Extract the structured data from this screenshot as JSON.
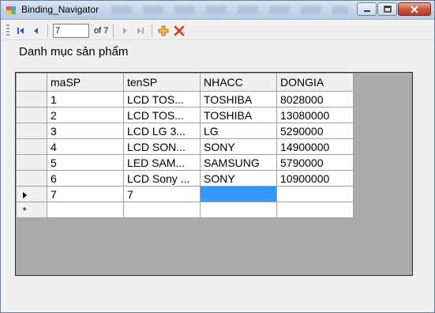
{
  "window": {
    "title": "Binding_Navigator"
  },
  "navigator": {
    "position_value": "7",
    "count_label": "of 7"
  },
  "section_label": "Danh mục sản phẩm",
  "grid": {
    "columns": [
      "maSP",
      "tenSP",
      "NHACC",
      "DONGIA"
    ],
    "rows": [
      [
        "1",
        "LCD TOS...",
        "TOSHIBA",
        "8028000"
      ],
      [
        "2",
        "LCD TOS...",
        "TOSHIBA",
        "13080000"
      ],
      [
        "3",
        "LCD LG 3...",
        "LG",
        "5290000"
      ],
      [
        "4",
        "LCD SON...",
        "SONY",
        "14900000"
      ],
      [
        "5",
        "LED SAM...",
        "SAMSUNG",
        "5790000"
      ],
      [
        "6",
        "LCD Sony ...",
        "SONY",
        "10900000"
      ],
      [
        "7",
        "7",
        "",
        ""
      ]
    ],
    "new_row_marker": "*"
  },
  "colors": {
    "selection": "#3399ff",
    "grid_background": "#ababab",
    "delete_icon": "#e03020",
    "add_icon": "#e8a317"
  }
}
